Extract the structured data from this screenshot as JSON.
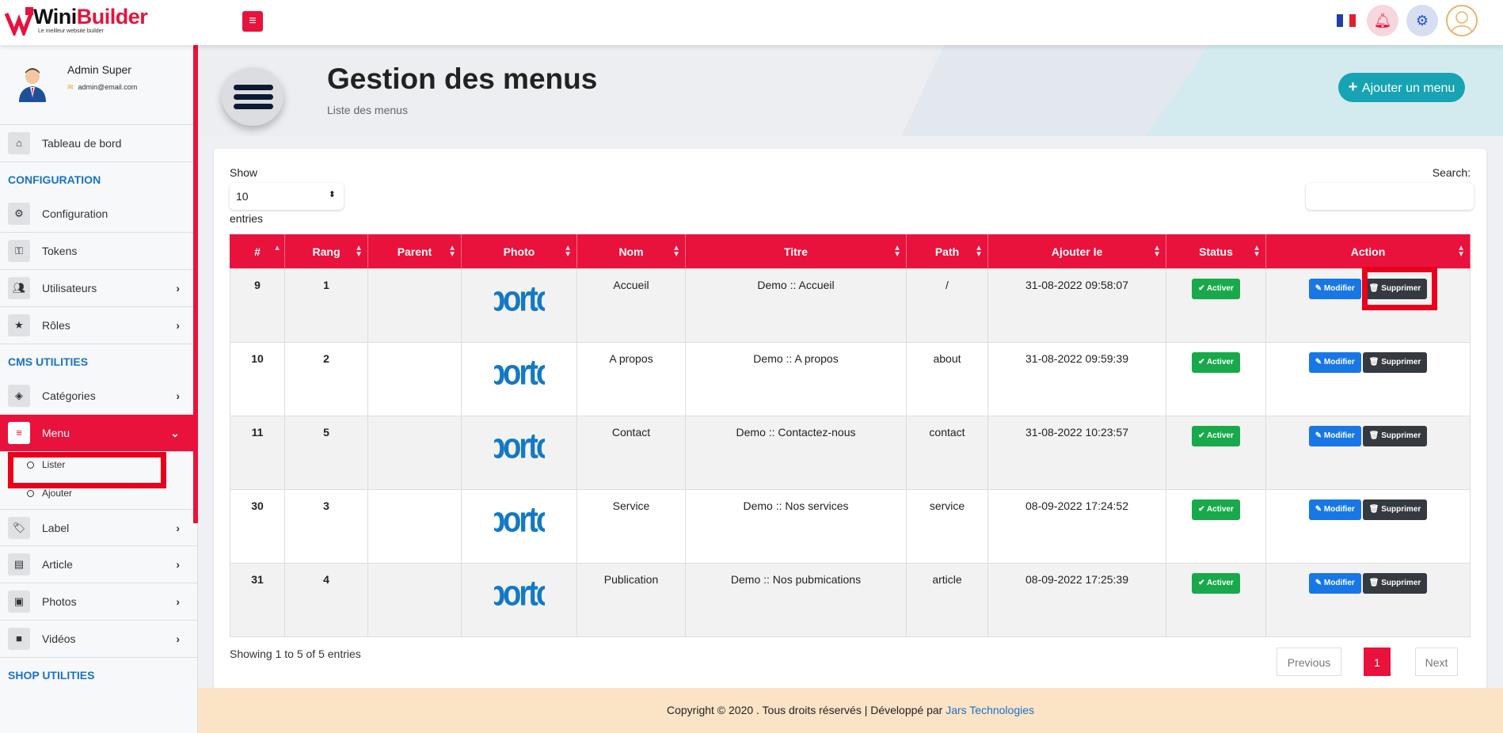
{
  "app": {
    "logo_text_1": "Wini",
    "logo_text_2": "Builder",
    "logo_tagline": "Le meilleur website builder"
  },
  "topbar": {
    "menu_toggle_icon": "hamburger-icon",
    "language_flag": "french-flag",
    "notification_icon": "bell-icon",
    "settings_icon": "gear-icon",
    "user_icon": "user-avatar-icon"
  },
  "sidebar": {
    "user_name": "Admin Super",
    "user_email": "admin@email.com",
    "items_top": [
      {
        "label": "Tableau de bord",
        "icon": "home-icon"
      }
    ],
    "section_config": "CONFIGURATION",
    "items_config": [
      {
        "label": "Configuration",
        "icon": "cogs-icon"
      },
      {
        "label": "Tokens",
        "icon": "key-icon"
      },
      {
        "label": "Utilisateurs",
        "icon": "users-icon",
        "chevron": "›"
      },
      {
        "label": "Rôles",
        "icon": "star-icon",
        "chevron": "›"
      }
    ],
    "section_cms": "CMS UTILITIES",
    "items_cms": [
      {
        "label": "Catégories",
        "icon": "shapes-icon",
        "chevron": "›"
      },
      {
        "label": "Menu",
        "icon": "list-icon",
        "chevron": "⌄"
      }
    ],
    "menu_sub": [
      {
        "label": "Lister"
      },
      {
        "label": "Ajouter"
      }
    ],
    "items_cms2": [
      {
        "label": "Label",
        "icon": "tags-icon",
        "chevron": "›"
      },
      {
        "label": "Article",
        "icon": "article-icon",
        "chevron": "›"
      },
      {
        "label": "Photos",
        "icon": "image-icon",
        "chevron": "›"
      },
      {
        "label": "Vidéos",
        "icon": "video-icon",
        "chevron": "›"
      }
    ],
    "section_shop": "SHOP UTILITIES"
  },
  "header": {
    "title": "Gestion des menus",
    "subtitle": "Liste des menus",
    "add_button": "Ajouter un menu",
    "add_icon": "plus-icon"
  },
  "table_controls": {
    "show_label": "Show",
    "entries_value": "10",
    "entries_label": "entries",
    "search_label": "Search:"
  },
  "table": {
    "columns": [
      "#",
      "Rang",
      "Parent",
      "Photo",
      "Nom",
      "Titre",
      "Path",
      "Ajouter le",
      "Status",
      "Action"
    ],
    "rows": [
      {
        "id": "9",
        "rang": "1",
        "parent": "",
        "photo": "porto",
        "nom": "Accueil",
        "titre": "Demo :: Accueil",
        "path": "/",
        "date": "31-08-2022 09:58:07",
        "status": "Activer"
      },
      {
        "id": "10",
        "rang": "2",
        "parent": "",
        "photo": "porto",
        "nom": "A propos",
        "titre": "Demo :: A propos",
        "path": "about",
        "date": "31-08-2022 09:59:39",
        "status": "Activer"
      },
      {
        "id": "11",
        "rang": "5",
        "parent": "",
        "photo": "porto",
        "nom": "Contact",
        "titre": "Demo :: Contactez-nous",
        "path": "contact",
        "date": "31-08-2022 10:23:57",
        "status": "Activer"
      },
      {
        "id": "30",
        "rang": "3",
        "parent": "",
        "photo": "porto",
        "nom": "Service",
        "titre": "Demo :: Nos services",
        "path": "service",
        "date": "08-09-2022 17:24:52",
        "status": "Activer"
      },
      {
        "id": "31",
        "rang": "4",
        "parent": "",
        "photo": "porto",
        "nom": "Publication",
        "titre": "Demo :: Nos pubmications",
        "path": "article",
        "date": "08-09-2022 17:25:39",
        "status": "Activer"
      }
    ],
    "modify_label": "Modifier",
    "delete_label": "Supprimer"
  },
  "pagination": {
    "info": "Showing 1 to 5 of 5 entries",
    "previous": "Previous",
    "current": "1",
    "next": "Next"
  },
  "footer": {
    "text": "Copyright © 2020 . Tous droits réservés | Développé par ",
    "link": "Jars Technologies"
  },
  "colors": {
    "accent": "#e8123c",
    "link": "#1a72c7",
    "success": "#18a94b",
    "primary": "#1877e6",
    "dark": "#343a40",
    "teal": "#17a3b3"
  }
}
